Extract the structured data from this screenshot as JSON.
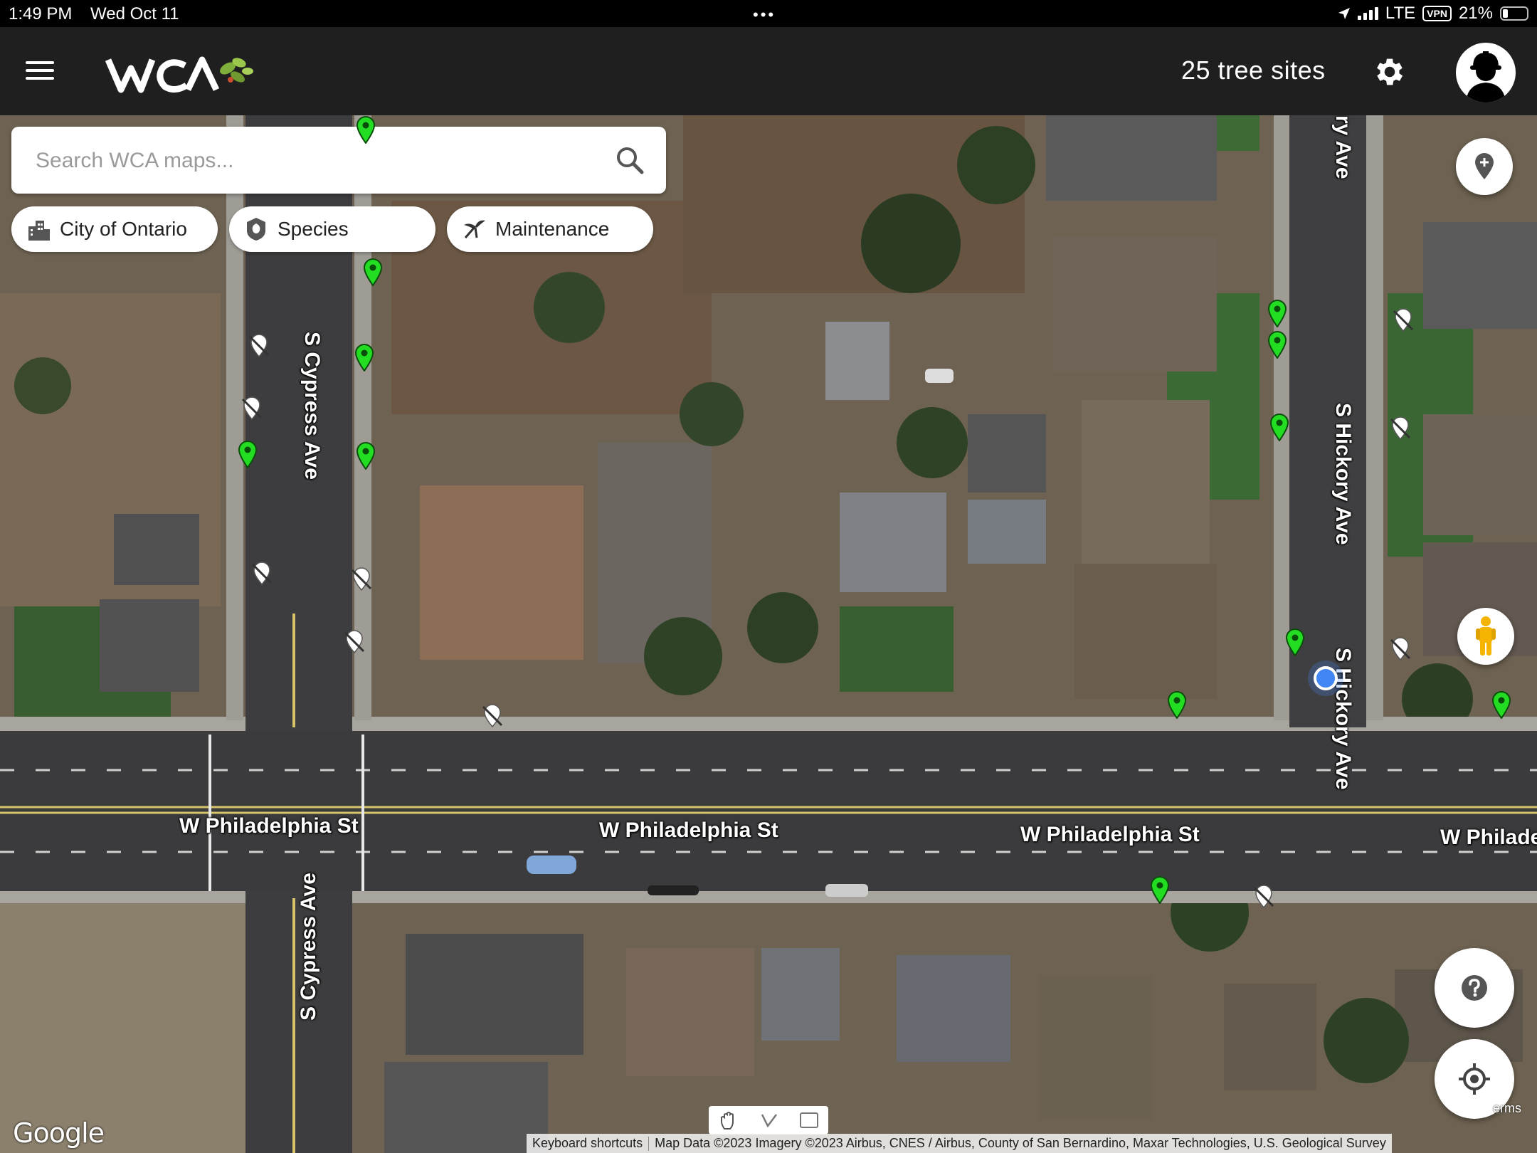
{
  "status_bar": {
    "time": "1:49 PM",
    "date": "Wed Oct 11",
    "dots": "•••",
    "network": "LTE",
    "vpn": "VPN",
    "battery": "21%",
    "battery_level": 0.21
  },
  "header": {
    "menu_icon": "hamburger-menu-icon",
    "logo_text": "WCA",
    "site_count": "25 tree sites",
    "settings_icon": "gear-icon",
    "profile_icon": "arborist-helmet-avatar-icon"
  },
  "search": {
    "placeholder": "Search WCA maps...",
    "value": "",
    "icon": "search-icon"
  },
  "filters": [
    {
      "label": "City of Ontario",
      "icon": "city-buildings-icon"
    },
    {
      "label": "Species",
      "icon": "leaf-badge-icon"
    },
    {
      "label": "Maintenance",
      "icon": "pruning-icon"
    }
  ],
  "map": {
    "street_labels": {
      "cypress_top": "S Cypress Ave",
      "cypress_bottom": "S Cypress Ave",
      "hickory_top": "ry Ave",
      "hickory_mid": "S Hickory Ave",
      "hickory_low": "S Hickory Ave",
      "philadelphia_1": "W Philadelphia St",
      "philadelphia_2": "W Philadelphia St",
      "philadelphia_3": "W Philadelphia St",
      "philadelphia_4": "W Philade"
    },
    "marker_colors": {
      "active": "#22dd22",
      "inactive": "#ffffff"
    },
    "google_logo": "Google",
    "keyboard_shortcuts": "Keyboard shortcuts",
    "attribution": "Map Data ©2023 Imagery ©2023 Airbus, CNES / Airbus, County of San Bernardino, Maxar Technologies, U.S. Geological Survey",
    "terms": "erms"
  },
  "fabs": {
    "add_pin_icon": "add-location-icon",
    "street_view_icon": "pegman-icon",
    "help_icon": "help-icon",
    "locate_icon": "my-location-icon"
  }
}
